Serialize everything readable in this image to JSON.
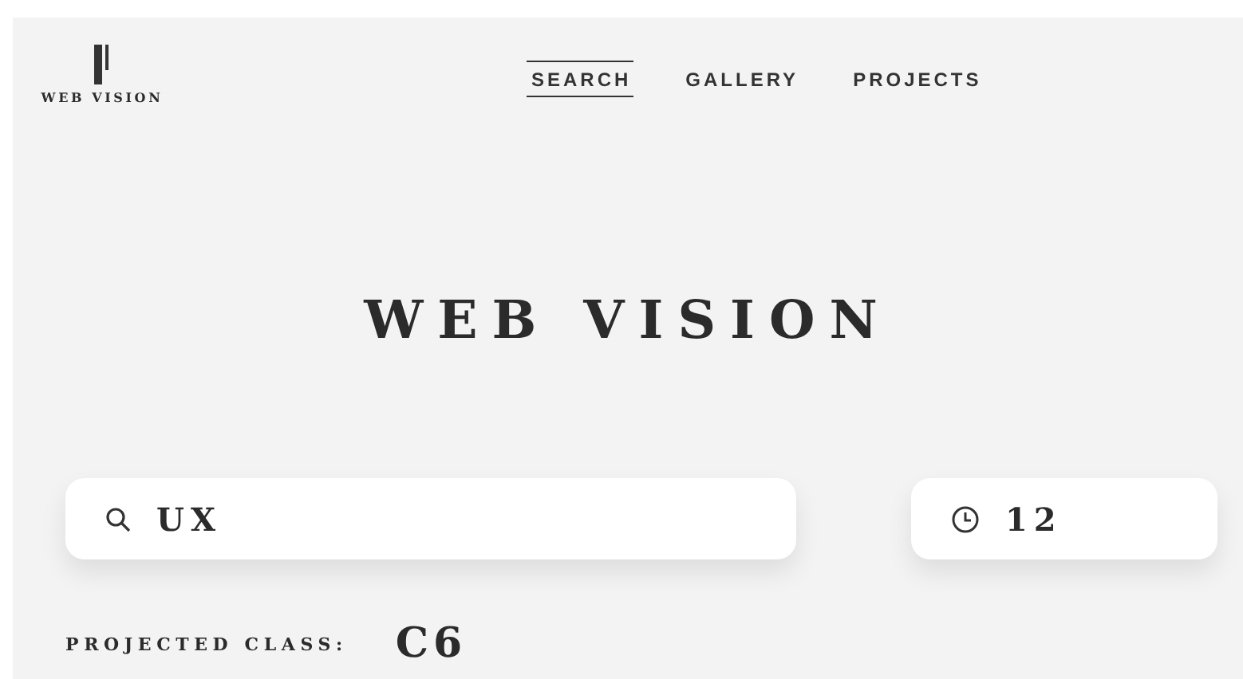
{
  "logo": {
    "text": "WEB VISION"
  },
  "nav": [
    {
      "label": "SEARCH",
      "selected": true
    },
    {
      "label": "GALLERY",
      "selected": false
    },
    {
      "label": "PROJECTS",
      "selected": false
    }
  ],
  "hero": {
    "title": "WEB VISION"
  },
  "search": {
    "value": "UX"
  },
  "time": {
    "value": "12"
  },
  "projected_class": {
    "label": "PROJECTED CLASS:",
    "value": "C6"
  }
}
